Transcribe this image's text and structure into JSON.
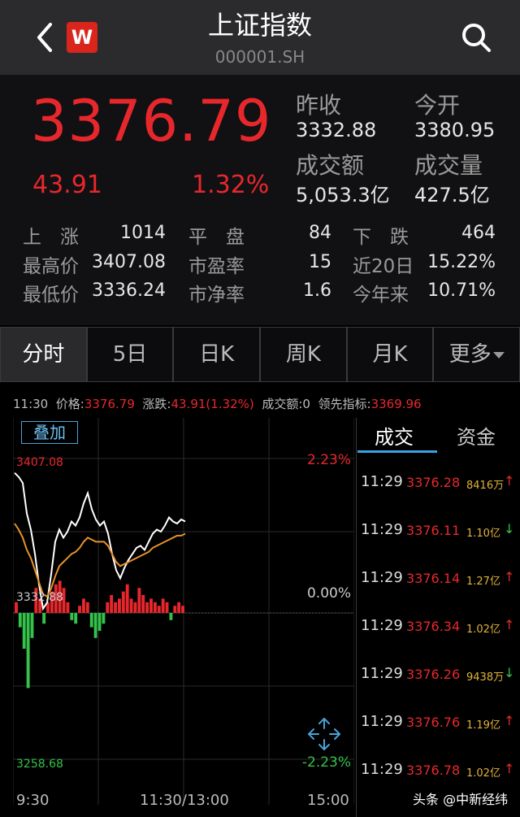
{
  "header": {
    "title": "上证指数",
    "code": "000001.SH",
    "logo_letter": "W"
  },
  "quote": {
    "price": "3376.79",
    "change": "43.91",
    "change_pct": "1.32%",
    "prev_close_label": "昨收",
    "prev_close": "3332.88",
    "open_label": "今开",
    "open": "3380.95",
    "turnover_label": "成交额",
    "turnover": "5,053.3亿",
    "volume_label": "成交量",
    "volume": "427.5亿"
  },
  "stats": [
    {
      "label": "上　涨",
      "value": "1014"
    },
    {
      "label": "平　盘",
      "value": "84"
    },
    {
      "label": "下　跌",
      "value": "464"
    },
    {
      "label": "最高价",
      "value": "3407.08"
    },
    {
      "label": "市盈率",
      "value": "15"
    },
    {
      "label": "近20日",
      "value": "15.22%"
    },
    {
      "label": "最低价",
      "value": "3336.24"
    },
    {
      "label": "市净率",
      "value": "1.6"
    },
    {
      "label": "今年来",
      "value": "10.71%"
    }
  ],
  "tabs": [
    "分时",
    "5日",
    "日K",
    "周K",
    "月K",
    "更多"
  ],
  "info": {
    "time": "11:30",
    "price_label": "价格:",
    "price": "3376.79",
    "change_label": "涨跌:",
    "change": "43.91(1.32%)",
    "volume_label": "成交额:",
    "volume": "0",
    "lead_label": "领先指标:",
    "lead": "3369.96"
  },
  "chart": {
    "overlay_label": "叠加",
    "high": "3407.08",
    "base": "3332.88",
    "low": "3258.68",
    "pct_top": "2.23%",
    "pct_mid": "0.00%",
    "pct_bot": "-2.23%",
    "time_start": "9:30",
    "time_mid": "11:30/13:00",
    "time_end": "15:00"
  },
  "chart_data": {
    "type": "line",
    "ylim": [
      3258.68,
      3407.08
    ],
    "base": 3332.88,
    "series": [
      {
        "values": [
          3400,
          3398,
          3395,
          3380,
          3372,
          3360,
          3345,
          3333,
          3336,
          3350,
          3366,
          3372,
          3368,
          3371,
          3376,
          3374,
          3378,
          3385,
          3390,
          3382,
          3377,
          3374,
          3376,
          3370,
          3360,
          3352,
          3348,
          3353,
          3357,
          3360,
          3363,
          3364,
          3362,
          3366,
          3370,
          3372,
          3371,
          3374,
          3378,
          3376,
          3375,
          3377,
          3376
        ]
      },
      {
        "values": [
          3375,
          3372,
          3368,
          3362,
          3358,
          3352,
          3346,
          3340,
          3339,
          3343,
          3349,
          3354,
          3356,
          3358,
          3360,
          3361,
          3363,
          3366,
          3368,
          3367,
          3366,
          3366,
          3366,
          3364,
          3360,
          3356,
          3354,
          3355,
          3356,
          3357,
          3358,
          3359,
          3360,
          3361,
          3363,
          3364,
          3365,
          3366,
          3367,
          3368,
          3369,
          3369,
          3370
        ]
      }
    ],
    "volume_bars": [
      6,
      -8,
      -20,
      -42,
      -14,
      14,
      8,
      -6,
      6,
      12,
      16,
      18,
      14,
      6,
      -4,
      -6,
      4,
      8,
      6,
      -8,
      -14,
      -10,
      -6,
      6,
      10,
      6,
      8,
      12,
      16,
      8,
      6,
      14,
      10,
      6,
      8,
      6,
      4,
      8,
      6,
      -4,
      4,
      6,
      4
    ]
  },
  "trades": {
    "tab_trade": "成交",
    "tab_fund": "资金",
    "rows": [
      {
        "time": "11:29",
        "price": "3376.28",
        "vol": "8416万",
        "dir": "up"
      },
      {
        "time": "11:29",
        "price": "3376.11",
        "vol": "1.10亿",
        "dir": "down"
      },
      {
        "time": "11:29",
        "price": "3376.14",
        "vol": "1.27亿",
        "dir": "up"
      },
      {
        "time": "11:29",
        "price": "3376.34",
        "vol": "1.02亿",
        "dir": "up"
      },
      {
        "time": "11:29",
        "price": "3376.26",
        "vol": "9438万",
        "dir": "down"
      },
      {
        "time": "11:29",
        "price": "3376.76",
        "vol": "1.19亿",
        "dir": "up"
      },
      {
        "time": "11:29",
        "price": "3376.78",
        "vol": "1.02亿",
        "dir": "up"
      }
    ]
  },
  "watermark": "头条 @中新经纬",
  "colors": {
    "up": "#e8272c",
    "down": "#34c24a",
    "accent": "#3aa2df"
  }
}
